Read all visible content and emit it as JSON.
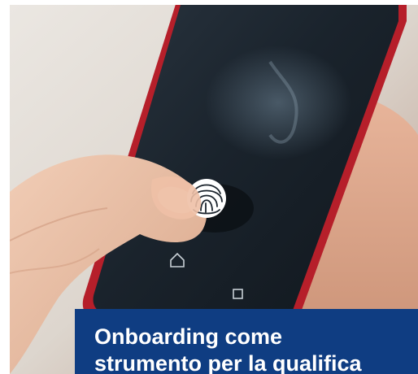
{
  "article": {
    "title_line_1": "Onboarding come",
    "title_line_2": "strumento per la qualifica"
  },
  "image": {
    "subject": "fingerprint-unlock-photo"
  },
  "colors": {
    "caption_background": "#0f3d82",
    "caption_text": "#ffffff",
    "phone_frame": "#c0202a"
  }
}
